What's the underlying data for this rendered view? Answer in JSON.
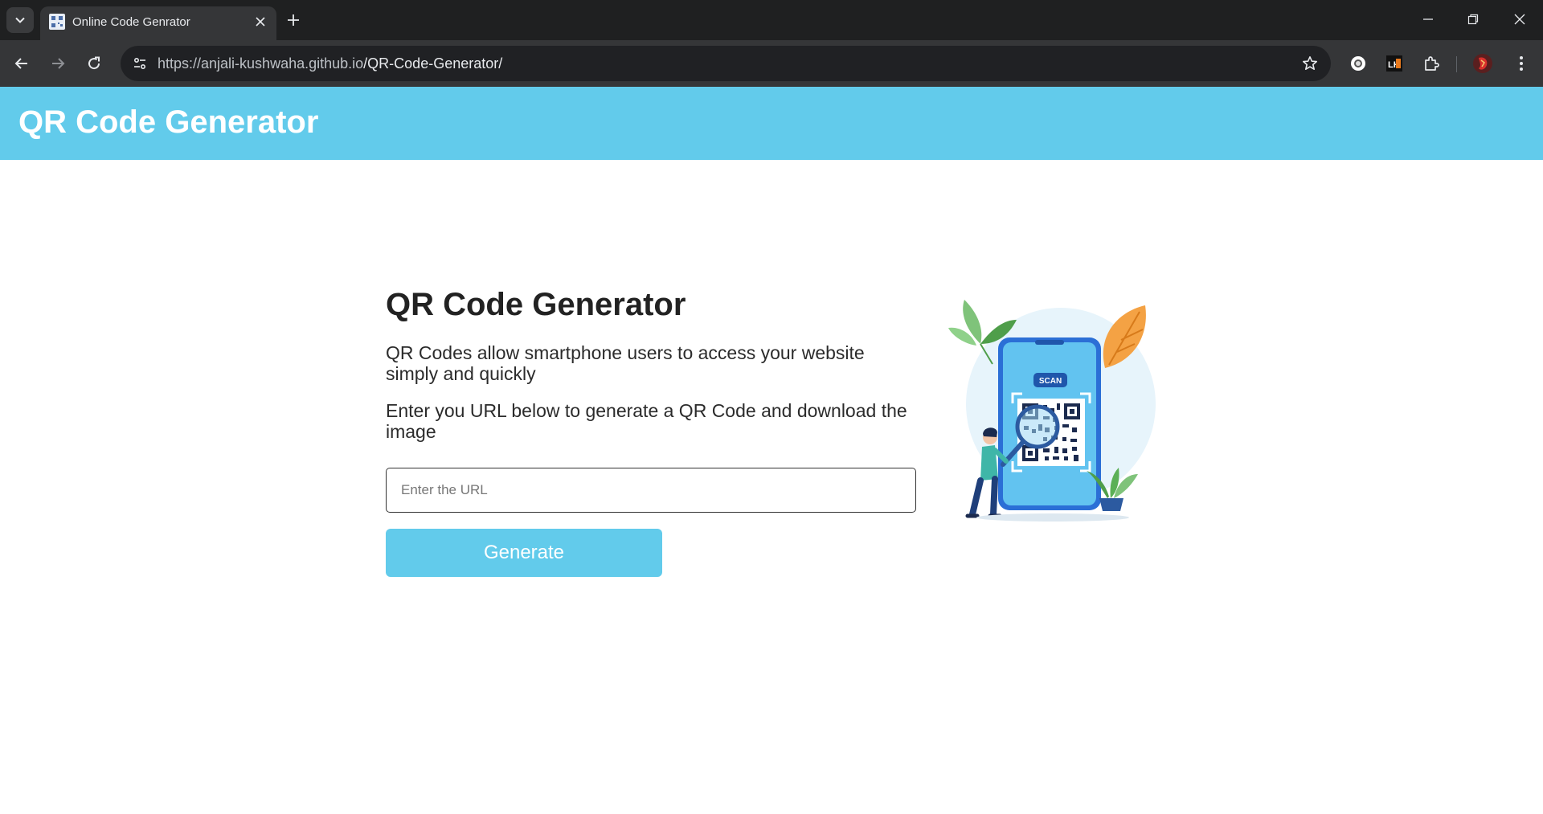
{
  "browser": {
    "tab_title": "Online Code Genrator",
    "url_host": "https://anjali-kushwaha.github.io",
    "url_path": "/QR-Code-Generator/",
    "icons": [
      "tab-search-icon",
      "favicon-icon",
      "close-icon",
      "plus-icon",
      "minimize-icon",
      "restore-icon",
      "close-window-icon",
      "back-arrow-icon",
      "forward-arrow-icon",
      "reload-icon",
      "site-info-icon",
      "star-icon",
      "extension-icon",
      "lighthouse-icon",
      "puzzle-icon",
      "profile-icon",
      "kebab-menu-icon"
    ],
    "extension_lh_label": "LH"
  },
  "header": {
    "logo": "QR Code Generator",
    "bg_color": "#62cbeb"
  },
  "main": {
    "title": "QR Code Generator",
    "paragraph1": "QR Codes allow smartphone users to access your website simply and quickly",
    "paragraph2": "Enter you URL below to generate a QR Code and download the image",
    "input_placeholder": "Enter the URL",
    "input_value": "",
    "button_label": "Generate",
    "illustration_badge": "SCAN"
  }
}
